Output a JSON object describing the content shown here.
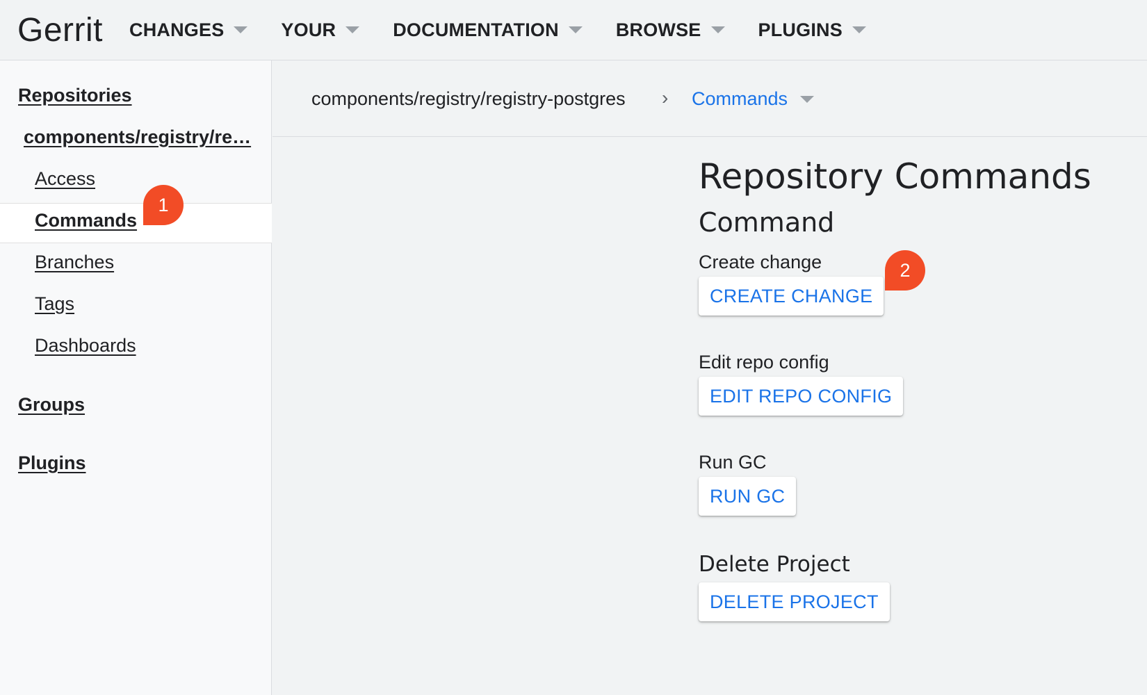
{
  "header": {
    "logo": "Gerrit",
    "nav": [
      {
        "label": "CHANGES"
      },
      {
        "label": "YOUR"
      },
      {
        "label": "DOCUMENTATION"
      },
      {
        "label": "BROWSE"
      },
      {
        "label": "PLUGINS"
      }
    ]
  },
  "sidebar": {
    "repositories": "Repositories",
    "repo": "components/registry/re…",
    "items": [
      {
        "label": "Access"
      },
      {
        "label": "Commands"
      },
      {
        "label": "Branches"
      },
      {
        "label": "Tags"
      },
      {
        "label": "Dashboards"
      }
    ],
    "selected": "Commands",
    "groups": "Groups",
    "plugins": "Plugins"
  },
  "breadcrumb": {
    "path": "components/registry/registry-postgres",
    "separator": "›",
    "current": "Commands"
  },
  "main": {
    "title": "Repository Commands",
    "subtitle": "Command",
    "commands": [
      {
        "label": "Create change",
        "button": "CREATE CHANGE"
      },
      {
        "label": "Edit repo config",
        "button": "EDIT REPO CONFIG"
      },
      {
        "label": "Run GC",
        "button": "RUN GC"
      },
      {
        "label": "Delete Project",
        "button": "DELETE PROJECT"
      }
    ]
  },
  "annotations": [
    {
      "number": "1"
    },
    {
      "number": "2"
    }
  ],
  "colors": {
    "accent": "#1a73e8",
    "annotation": "#f24c26",
    "background": "#f1f3f4"
  }
}
